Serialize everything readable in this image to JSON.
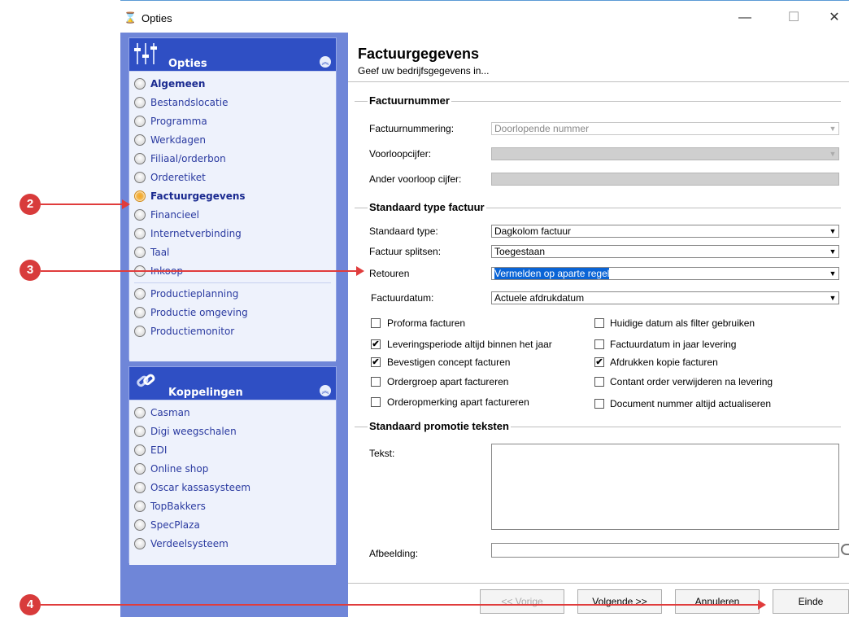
{
  "window": {
    "title": "Opties",
    "minimize": "—",
    "maximize": "☐",
    "close": "✕"
  },
  "sidebar": {
    "opties": {
      "title": "Opties",
      "items": [
        {
          "label": "Algemeen"
        },
        {
          "label": "Bestandslocatie"
        },
        {
          "label": "Programma"
        },
        {
          "label": "Werkdagen"
        },
        {
          "label": "Filiaal/orderbon"
        },
        {
          "label": "Orderetiket"
        },
        {
          "label": "Factuurgegevens"
        },
        {
          "label": "Financieel"
        },
        {
          "label": "Internetverbinding"
        },
        {
          "label": "Taal"
        },
        {
          "label": "Inkoop"
        },
        {
          "label": "Productieplanning"
        },
        {
          "label": "Productie omgeving"
        },
        {
          "label": "Productiemonitor"
        }
      ]
    },
    "koppelingen": {
      "title": "Koppelingen",
      "items": [
        {
          "label": "Casman"
        },
        {
          "label": "Digi weegschalen"
        },
        {
          "label": "EDI"
        },
        {
          "label": "Online shop"
        },
        {
          "label": "Oscar kassasysteem"
        },
        {
          "label": "TopBakkers"
        },
        {
          "label": "SpecPlaza"
        },
        {
          "label": "Verdeelsysteem"
        }
      ]
    }
  },
  "main": {
    "title": "Factuurgegevens",
    "subtitle": "Geef uw bedrijfsgegevens in...",
    "sections": {
      "factuurnummer": "Factuurnummer",
      "standaard_type": "Standaard type factuur",
      "promotie": "Standaard promotie teksten"
    },
    "fields": {
      "factuurnummering_label": "Factuurnummering:",
      "factuurnummering_value": "Doorlopende nummer",
      "voorloopcijfer_label": "Voorloopcijfer:",
      "ander_voorloop_label": "Ander voorloop cijfer:",
      "standaard_type_label": "Standaard type:",
      "standaard_type_value": "Dagkolom factuur",
      "splitsen_label": "Factuur splitsen:",
      "splitsen_value": "Toegestaan",
      "retouren_label": "Retouren",
      "retouren_value": "Vermelden op aparte regel",
      "factuurdatum_label": "Factuurdatum:",
      "factuurdatum_value": "Actuele afdrukdatum",
      "tekst_label": "Tekst:",
      "afbeelding_label": "Afbeelding:"
    },
    "checkboxes": {
      "proforma": {
        "label": "Proforma facturen",
        "checked": false
      },
      "leveringsperiode": {
        "label": "Leveringsperiode altijd binnen het jaar",
        "checked": true
      },
      "bevestigen": {
        "label": "Bevestigen concept facturen",
        "checked": true
      },
      "ordergroep": {
        "label": "Ordergroep apart factureren",
        "checked": false
      },
      "orderopmerking": {
        "label": "Orderopmerking apart factureren",
        "checked": false
      },
      "huidige_datum": {
        "label": "Huidige datum als filter gebruiken",
        "checked": false
      },
      "factuurdatum_jaar": {
        "label": "Factuurdatum in jaar levering",
        "checked": false
      },
      "afdrukken_kopie": {
        "label": "Afdrukken kopie facturen",
        "checked": true
      },
      "contant_order": {
        "label": "Contant order verwijderen na levering",
        "checked": false
      },
      "document_nummer": {
        "label": "Document nummer altijd actualiseren",
        "checked": false
      }
    },
    "checkmark": "✔"
  },
  "buttons": {
    "vorige": "<< Vorige",
    "volgende": "Volgende >>",
    "annuleren": "Annuleren",
    "einde": "Einde"
  },
  "annotations": {
    "m2": "2",
    "m3": "3",
    "m4": "4"
  },
  "colors": {
    "accent": "#2f4fc4",
    "panel": "#6f86d8",
    "selection": "#0a64d6",
    "annotation": "#d83b3b"
  }
}
